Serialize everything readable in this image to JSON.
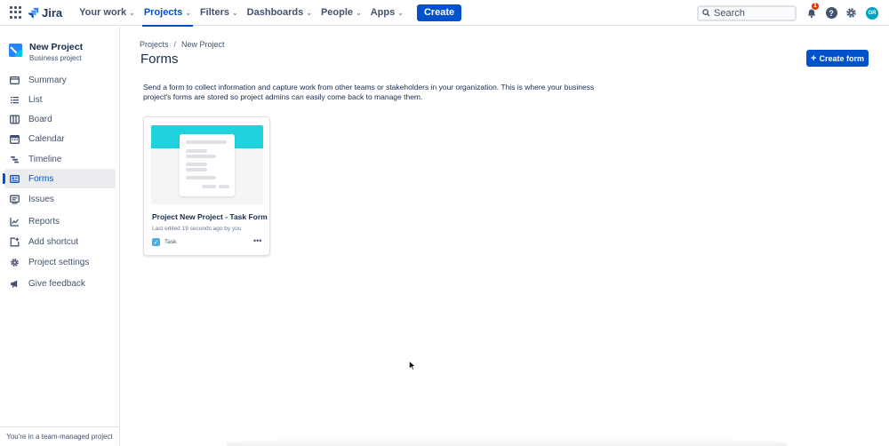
{
  "topnav": {
    "logo_text": "Jira",
    "items": [
      {
        "label": "Your work"
      },
      {
        "label": "Projects"
      },
      {
        "label": "Filters"
      },
      {
        "label": "Dashboards"
      },
      {
        "label": "People"
      },
      {
        "label": "Apps"
      }
    ],
    "active_item": "Projects",
    "create_label": "Create",
    "search_placeholder": "Search",
    "notifications_count": "1",
    "avatar_initials": "GR",
    "colors": {
      "accent": "#0052CC",
      "badge": "#DE350B",
      "avatar": "#00A3BF"
    }
  },
  "sidebar": {
    "project_name": "New Project",
    "project_type": "Business project",
    "items": [
      {
        "label": "Summary",
        "icon": "summary-icon"
      },
      {
        "label": "List",
        "icon": "list-icon"
      },
      {
        "label": "Board",
        "icon": "board-icon"
      },
      {
        "label": "Calendar",
        "icon": "calendar-icon"
      },
      {
        "label": "Timeline",
        "icon": "timeline-icon"
      },
      {
        "label": "Forms",
        "icon": "forms-icon"
      },
      {
        "label": "Issues",
        "icon": "issues-icon"
      },
      {
        "label": "Reports",
        "icon": "reports-icon"
      },
      {
        "label": "Add shortcut",
        "icon": "add-shortcut-icon"
      },
      {
        "label": "Project settings",
        "icon": "gear-icon"
      },
      {
        "label": "Give feedback",
        "icon": "megaphone-icon"
      }
    ],
    "active_item": "Forms",
    "footer": "You're in a team-managed project"
  },
  "main": {
    "breadcrumb": [
      "Projects",
      "New Project"
    ],
    "title": "Forms",
    "create_form_label": "Create form",
    "description": "Send a form to collect information and capture work from other teams or stakeholders in your organization. This is where your business project's forms are stored so project admins can easily come back to manage them.",
    "forms": [
      {
        "title": "Project New Project - Task Form",
        "meta": "Last edited 19 seconds ago by you",
        "issue_type": "Task",
        "issue_icon": "task-checkbox-icon"
      }
    ]
  }
}
